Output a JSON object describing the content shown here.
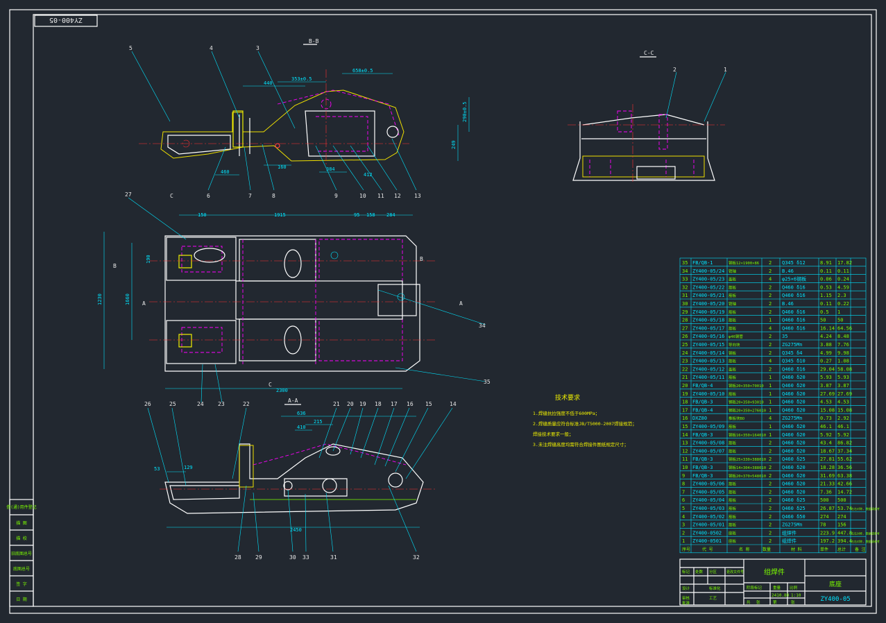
{
  "drawing": {
    "code_box": "ZY400-05",
    "sections": {
      "bb": "B-B",
      "cc": "C-C",
      "aa": "A-A",
      "c_top": "C",
      "c_bottom": "C",
      "a_left": "A",
      "a_right": "A",
      "b_left": "B",
      "b_right": "B"
    },
    "balloons_top": [
      "5",
      "4",
      "3",
      "1",
      "2"
    ],
    "balloons_top_bottom": [
      "6",
      "7",
      "8",
      "9",
      "10",
      "11",
      "12",
      "13"
    ],
    "balloons_mid": [
      "27",
      "34",
      "35",
      "24",
      "23"
    ],
    "balloons_low_top": [
      "26",
      "25",
      "22",
      "21",
      "20",
      "19",
      "18",
      "17",
      "16",
      "15",
      "14"
    ],
    "balloons_low_bottom": [
      "28",
      "29",
      "30",
      "33",
      "31",
      "32"
    ],
    "dims_top": [
      "658±0.5",
      "353±0.5",
      "440",
      "290±0.5",
      "249",
      "460",
      "160",
      "384",
      "412"
    ],
    "dims_mid": [
      "150",
      "1915",
      "95",
      "158",
      "284",
      "1230",
      "1660",
      "190",
      "2300"
    ],
    "dims_low": [
      "636",
      "215",
      "410",
      "53",
      "129",
      "2450"
    ],
    "tech_title": "技术要求",
    "tech_notes": [
      "1.焊缝抗拉强度不低于600MPa；",
      "2.焊缝质量应符合标准JB/T5000-2007焊接规范；",
      "  焊接技术要求一般；",
      "3.未注焊缝高度均需符合焊接件图纸规定尺寸；"
    ],
    "left_strip": [
      "借(通)用件登记",
      "描  图",
      "描  校",
      "旧底图总号",
      "底图总号",
      "签  字",
      "日  期"
    ]
  },
  "bom": {
    "rows": [
      [
        "35",
        "FB/QB-1",
        "钢板12×1900×86",
        "2",
        "Q345 δ12",
        "8.91",
        "17.82"
      ],
      [
        "34",
        "ZY400-05/24",
        "销轴",
        "2",
        "B.46",
        "0.11",
        "0.11"
      ],
      [
        "33",
        "ZY400-05/23",
        "盖板",
        "4",
        "φ25×6钢板",
        "0.06",
        "0.24"
      ],
      [
        "32",
        "ZY400-05/22",
        "筋板",
        "2",
        "Q460 δ16",
        "0.53",
        "4.59"
      ],
      [
        "31",
        "ZY400-05/21",
        "筋板",
        "2",
        "Q460 δ16",
        "1.15",
        "2.3"
      ],
      [
        "30",
        "ZY400-05/20",
        "销轴",
        "2",
        "B.46",
        "0.11",
        "0.22"
      ],
      [
        "29",
        "ZY400-05/19",
        "筋板",
        "2",
        "Q460 δ16",
        "0.5",
        "1"
      ],
      [
        "28",
        "ZY400-05/18",
        "筋板",
        "1",
        "Q460 δ16",
        "50",
        "50"
      ],
      [
        "27",
        "ZY400-05/17",
        "筋板",
        "4",
        "Q460 δ16",
        "16.14",
        "64.56"
      ],
      [
        "26",
        "ZY400-05/16",
        "φ46钢管",
        "2",
        "35",
        "4.24",
        "8.48"
      ],
      [
        "25",
        "ZY400-05/15",
        "导向块",
        "2",
        "ZG275Mn",
        "3.88",
        "7.76"
      ],
      [
        "24",
        "ZY400-05/14",
        "钢板",
        "2",
        "Q345 δ4",
        "4.99",
        "9.98"
      ],
      [
        "23",
        "ZY400-05/13",
        "筋板",
        "4",
        "Q345 δ10",
        "0.27",
        "1.08"
      ],
      [
        "22",
        "ZY400-05/12",
        "盖板",
        "2",
        "Q460 δ16",
        "29.04",
        "58.08"
      ],
      [
        "21",
        "ZY400-05/11",
        "筋板",
        "1",
        "Q460 δ20",
        "5.93",
        "5.93"
      ],
      [
        "20",
        "FB/QB-4",
        "钢板20×350×70010",
        "1",
        "Q460 δ20",
        "3.87",
        "3.87"
      ],
      [
        "19",
        "ZY400-05/10",
        "筋板",
        "1",
        "Q460 δ20",
        "27.69",
        "27.69"
      ],
      [
        "18",
        "FB/QB-3",
        "钢板20×350×93010",
        "1",
        "Q460 δ20",
        "4.53",
        "4.53"
      ],
      [
        "17",
        "FB/QB-4",
        "钢板20×350×276010",
        "1",
        "Q460 δ20",
        "15.08",
        "15.08"
      ],
      [
        "16",
        "DXZ80",
        "推板块BO",
        "4",
        "ZG275Mn",
        "0.73",
        "2.92"
      ],
      [
        "15",
        "ZY400-05/09",
        "筋板",
        "1",
        "Q460 δ20",
        "46.1",
        "46.1"
      ],
      [
        "14",
        "FB/QB-3",
        "钢板16×350×164010",
        "1",
        "Q460 δ20",
        "5.92",
        "5.92"
      ],
      [
        "13",
        "ZY400-05/08",
        "筋板",
        "2",
        "Q460 δ20",
        "43.4",
        "86.82"
      ],
      [
        "12",
        "ZY400-05/07",
        "筋板",
        "2",
        "Q460 δ20",
        "18.67",
        "37.34"
      ],
      [
        "11",
        "FB/QB-3",
        "钢板25×330×388010",
        "2",
        "Q460 δ25",
        "27.81",
        "55.62"
      ],
      [
        "10",
        "FB/QB-3",
        "钢板14×304×388010",
        "2",
        "Q460 δ20",
        "18.28",
        "36.56"
      ],
      [
        "9",
        "FB/QB-3",
        "钢板20×370×548010",
        "2",
        "Q460 δ20",
        "31.69",
        "63.38"
      ],
      [
        "8",
        "ZY400-05/06",
        "筋板",
        "2",
        "Q460 δ20",
        "21.33",
        "42.66"
      ],
      [
        "7",
        "ZY400-05/05",
        "筋板",
        "2",
        "Q460 δ20",
        "7.36",
        "14.72"
      ],
      [
        "6",
        "ZY400-05/04",
        "筋板",
        "2",
        "Q460 δ25",
        "500",
        "500"
      ],
      [
        "5",
        "ZY400-05/03",
        "筋板",
        "2",
        "Q460 δ25",
        "26.87",
        "53.74"
      ],
      [
        "4",
        "ZY400-05/02",
        "筋板",
        "2",
        "Q460 δ50",
        "274",
        "274"
      ],
      [
        "3",
        "ZY400-05/01",
        "筋板",
        "2",
        "ZG275Mn",
        "78",
        "156"
      ],
      [
        "2",
        "ZY400-0502",
        "座板",
        "2",
        "组焊件",
        "223.9",
        "447.8"
      ],
      [
        "1",
        "ZY400-0501",
        "座板",
        "2",
        "组焊件",
        "197.2",
        "394.4"
      ]
    ],
    "header": [
      "序号",
      "代  号",
      "名  称",
      "数量",
      "材  料",
      "单件",
      "总计",
      "备  注"
    ],
    "row_notes": {
      "5": "左右对称, 数据请参考",
      "2": "左右对称, 数据请参考",
      "1": "左右对称, 数据请参考"
    }
  },
  "title_block": {
    "assembly_name": "组焊件",
    "part_name": "底座",
    "drawing_no": "ZY400-05",
    "weight": "2410.80",
    "scale": "1:10",
    "labels": [
      "标记",
      "处数",
      "分区",
      "更改文件号",
      "签名",
      "年月日",
      "设计",
      "标准化",
      "阶段标记",
      "重量",
      "比例",
      "审核",
      "工艺",
      "批准",
      "共",
      "张",
      "第",
      "张"
    ]
  }
}
